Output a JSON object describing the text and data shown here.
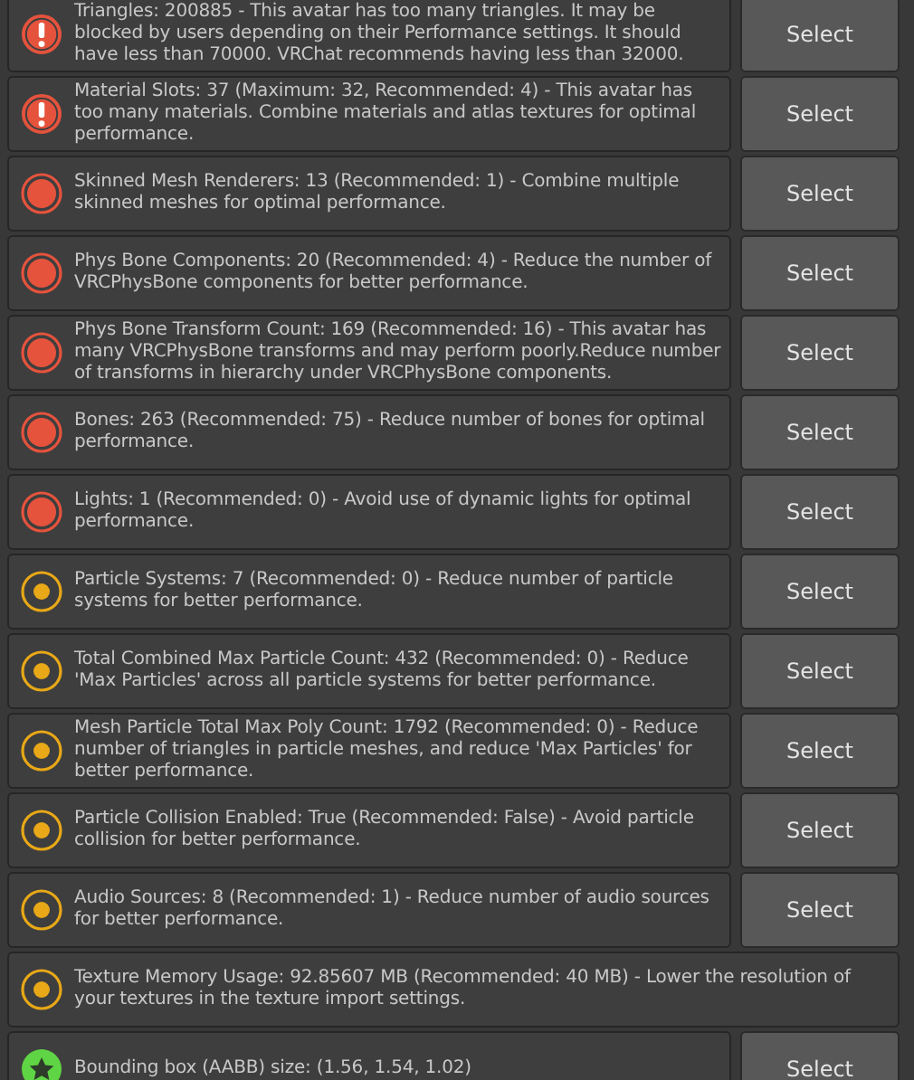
{
  "messages": [
    {
      "kind": "error",
      "text": "Triangles: 200885 - This avatar has too many triangles. It may be blocked by users depending on their Performance settings. It should have less than 70000. VRChat recommends having less than 32000.",
      "button": "Select"
    },
    {
      "kind": "error",
      "text": "Material Slots: 37 (Maximum: 32, Recommended: 4) - This avatar has too many materials. Combine materials and atlas textures for optimal performance.",
      "button": "Select"
    },
    {
      "kind": "poor",
      "text": "Skinned Mesh Renderers: 13 (Recommended: 1) - Combine multiple skinned meshes for optimal performance.",
      "button": "Select"
    },
    {
      "kind": "poor",
      "text": "Phys Bone Components: 20 (Recommended: 4) - Reduce the number of VRCPhysBone components for better performance.",
      "button": "Select"
    },
    {
      "kind": "poor",
      "text": "Phys Bone Transform Count: 169 (Recommended: 16) - This avatar has many VRCPhysBone transforms and may perform poorly.Reduce number of transforms in hierarchy under VRCPhysBone components.",
      "button": "Select"
    },
    {
      "kind": "poor",
      "text": "Bones: 263 (Recommended: 75) - Reduce number of bones for optimal performance.",
      "button": "Select"
    },
    {
      "kind": "poor",
      "text": "Lights: 1 (Recommended: 0) - Avoid use of dynamic lights for optimal performance.",
      "button": "Select"
    },
    {
      "kind": "medium",
      "text": "Particle Systems: 7 (Recommended: 0) - Reduce number of particle systems for better performance.",
      "button": "Select"
    },
    {
      "kind": "medium",
      "text": "Total Combined Max Particle Count: 432 (Recommended: 0) - Reduce 'Max Particles' across all particle systems for better performance.",
      "button": "Select"
    },
    {
      "kind": "medium",
      "text": "Mesh Particle Total Max Poly Count: 1792 (Recommended: 0) - Reduce number of triangles in particle meshes, and reduce 'Max Particles' for better performance.",
      "button": "Select"
    },
    {
      "kind": "medium",
      "text": "Particle Collision Enabled: True (Recommended: False) - Avoid particle collision for better performance.",
      "button": "Select"
    },
    {
      "kind": "medium",
      "text": "Audio Sources: 8 (Recommended: 1) - Reduce number of audio sources for better performance.",
      "button": "Select"
    },
    {
      "kind": "medium",
      "text": "Texture Memory Usage: 92.85607 MB (Recommended: 40 MB) - Lower the resolution of your textures in the texture import settings."
    },
    {
      "kind": "good",
      "text": "Bounding box (AABB) size: (1.56, 1.54, 1.02)",
      "button": "Select"
    }
  ]
}
